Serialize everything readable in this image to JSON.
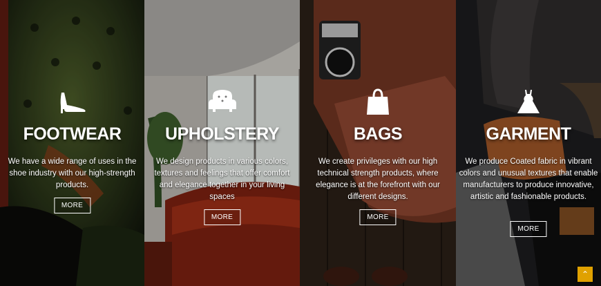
{
  "panels": [
    {
      "id": "footwear",
      "icon": "high-heel-shoe-icon",
      "title": "FOOTWEAR",
      "description": "We have a wide range of uses in the shoe industry with our high-strength products.",
      "more_label": "MORE"
    },
    {
      "id": "upholstery",
      "icon": "armchair-icon",
      "title": "UPHOLSTERY",
      "description": "We design products in various colors, textures and feelings that offer comfort and elegance together in your living spaces",
      "more_label": "MORE"
    },
    {
      "id": "bags",
      "icon": "shopping-bag-icon",
      "title": "BAGS",
      "description": "We create privileges with our high technical strength products, where elegance is at the forefront with our different designs.",
      "more_label": "MORE"
    },
    {
      "id": "garment",
      "icon": "dress-icon",
      "title": "GARMENT",
      "description": "We produce Coated fabric in vibrant colors and unusual textures that enable manufacturers to produce innovative, artistic and fashionable products.",
      "more_label": "MORE"
    }
  ],
  "scroll_top_icon": "chevron-up-icon",
  "colors": {
    "accent": "#e0a100"
  }
}
